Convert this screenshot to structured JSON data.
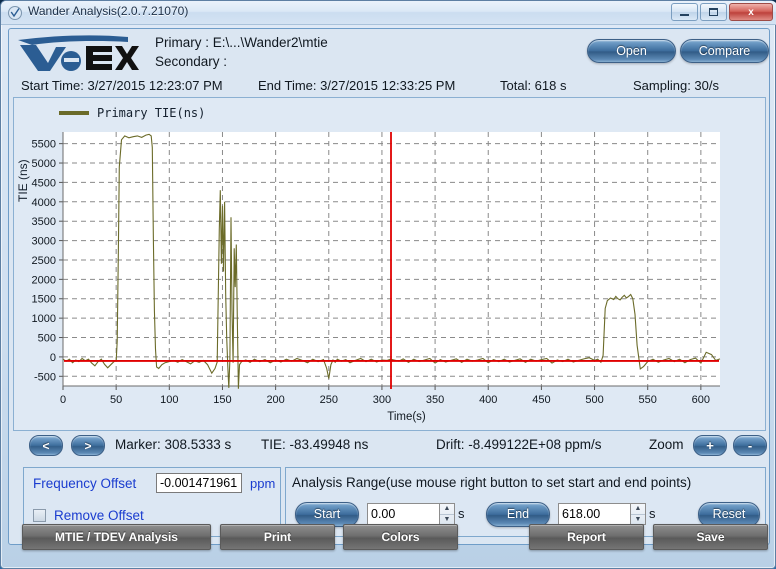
{
  "window": {
    "title": "Wander Analysis(2.0.7.21070)",
    "icon": "app-circle-icon",
    "minimize_label": "minimize",
    "maximize_label": "maximize",
    "close_label": "x"
  },
  "header": {
    "logo_text_primary": "Ve",
    "logo_text_secondary": "EX",
    "primary_path": "Primary : E:\\...\\Wander2\\mtie",
    "secondary_path": "Secondary :",
    "open_label": "Open",
    "compare_label": "Compare"
  },
  "info": {
    "start_time": "Start Time: 3/27/2015 12:23:07 PM",
    "end_time": "End Time: 3/27/2015 12:33:25 PM",
    "total": "Total: 618 s",
    "sampling": "Sampling: 30/s"
  },
  "marker": {
    "prev_label": "<",
    "next_label": ">",
    "marker_text": "Marker: 308.5333 s",
    "tie_text": "TIE: -83.49948 ns",
    "drift_text": "Drift: -8.499122E+08 ppm/s",
    "zoom_label": "Zoom",
    "zoom_in_label": "+",
    "zoom_out_label": "-"
  },
  "offset_panel": {
    "frequency_offset_label": "Frequency Offset",
    "frequency_offset_value": "-0.001471961",
    "unit_label": "ppm",
    "remove_offset_label": "Remove Offset",
    "remove_offset_checked": false
  },
  "range_panel": {
    "title": "Analysis Range(use mouse right button to set start and end points)",
    "start_label": "Start",
    "start_value": "0.00",
    "start_unit": "s",
    "end_label": "End",
    "end_value": "618.00",
    "end_unit": "s",
    "reset_label": "Reset"
  },
  "toolbar": {
    "mtie_label": "MTIE / TDEV Analysis",
    "print_label": "Print",
    "colors_label": "Colors",
    "report_label": "Report",
    "save_label": "Save"
  },
  "colors": {
    "trace": "#6b6b29",
    "zero_line": "#e00000",
    "marker_line": "#e00000",
    "grid": "#8a8a8a",
    "plot_bg": "#ffffff",
    "panel_bg": "#dbe6f2",
    "accent_blue": "#1a3ccf",
    "logo_blue": "#2b5d93"
  },
  "chart_data": {
    "type": "line",
    "title": "",
    "xlabel": "Time(s)",
    "ylabel": "TIE (ns)",
    "legend": [
      "Primary TIE(ns)"
    ],
    "legend_position": "top-left",
    "grid": true,
    "xlim": [
      0,
      618
    ],
    "ylim": [
      -750,
      5800
    ],
    "xticks": [
      0,
      50,
      100,
      150,
      200,
      250,
      300,
      350,
      400,
      450,
      500,
      550,
      600
    ],
    "yticks": [
      -500,
      0,
      500,
      1000,
      1500,
      2000,
      2500,
      3000,
      3500,
      4000,
      4500,
      5000,
      5500
    ],
    "zero_line": 0,
    "marker_x": 308.5333,
    "marker_tie": -83.49948,
    "series": [
      {
        "name": "Primary TIE(ns)",
        "color": "#6b6b29",
        "x": [
          0,
          3,
          6,
          9,
          12,
          15,
          18,
          21,
          24,
          27,
          30,
          33,
          36,
          39,
          42,
          45,
          48,
          50,
          51,
          52,
          53,
          55,
          58,
          62,
          66,
          70,
          74,
          78,
          81,
          83,
          84,
          85,
          86,
          87,
          88,
          90,
          93,
          96,
          100,
          104,
          108,
          112,
          116,
          120,
          124,
          128,
          132,
          136,
          140,
          143,
          145,
          147,
          148,
          149,
          150,
          151,
          152,
          153,
          154,
          155,
          156,
          157,
          158,
          159,
          160,
          161,
          162,
          163,
          164,
          165,
          166,
          168,
          172,
          176,
          180,
          185,
          190,
          195,
          200,
          205,
          210,
          215,
          220,
          225,
          230,
          235,
          240,
          245,
          248,
          250,
          252,
          254,
          256,
          258,
          262,
          266,
          270,
          275,
          280,
          285,
          290,
          295,
          300,
          305,
          308,
          312,
          316,
          320,
          325,
          330,
          335,
          340,
          345,
          350,
          355,
          360,
          365,
          370,
          375,
          380,
          385,
          390,
          395,
          400,
          405,
          410,
          415,
          420,
          425,
          430,
          435,
          440,
          445,
          450,
          455,
          460,
          465,
          470,
          475,
          480,
          485,
          490,
          495,
          500,
          503,
          506,
          508,
          510,
          512,
          515,
          518,
          520,
          522,
          524,
          526,
          528,
          530,
          532,
          534,
          536,
          538,
          540,
          543,
          546,
          550,
          555,
          560,
          565,
          570,
          575,
          580,
          585,
          590,
          595,
          600,
          605,
          610,
          614,
          618
        ],
        "y": [
          -60,
          -110,
          -60,
          -150,
          -80,
          -120,
          -40,
          -100,
          -60,
          -160,
          -230,
          -120,
          -60,
          -190,
          -280,
          -200,
          -120,
          -90,
          400,
          2600,
          4900,
          5600,
          5700,
          5650,
          5680,
          5700,
          5660,
          5720,
          5740,
          5700,
          5400,
          3000,
          1200,
          200,
          -260,
          -300,
          -200,
          -150,
          -120,
          -90,
          -140,
          -70,
          -120,
          -180,
          -100,
          -140,
          -90,
          -200,
          -420,
          -300,
          -130,
          3300,
          4300,
          2400,
          3900,
          2200,
          4000,
          1600,
          500,
          -250,
          -800,
          -60,
          3600,
          1200,
          -150,
          2800,
          1800,
          2900,
          1000,
          -820,
          -200,
          -120,
          -80,
          -140,
          -60,
          -120,
          -70,
          -150,
          -80,
          -130,
          -60,
          -110,
          -40,
          -90,
          -150,
          -60,
          -120,
          -70,
          -300,
          -560,
          -200,
          -80,
          -140,
          -60,
          -110,
          -70,
          -150,
          -90,
          -40,
          -120,
          -60,
          -130,
          -80,
          -90,
          -60,
          -83,
          -110,
          -50,
          -140,
          -60,
          -120,
          -80,
          -40,
          -160,
          -70,
          -130,
          -90,
          -50,
          -140,
          -60,
          -110,
          -80,
          -40,
          -150,
          -70,
          -120,
          -60,
          -130,
          -90,
          -50,
          -140,
          -60,
          -110,
          -70,
          -40,
          -160,
          -80,
          -120,
          -60,
          -130,
          -90,
          -50,
          -20,
          -90,
          -60,
          -140,
          40,
          1250,
          1450,
          1520,
          1480,
          1560,
          1500,
          1470,
          1540,
          1590,
          1520,
          1560,
          1610,
          1500,
          1100,
          300,
          -310,
          -250,
          -120,
          -60,
          -140,
          -80,
          -40,
          -120,
          -60,
          -150,
          -70,
          -30,
          -160,
          120,
          60,
          -90,
          -50,
          -120,
          -60
        ]
      }
    ]
  }
}
